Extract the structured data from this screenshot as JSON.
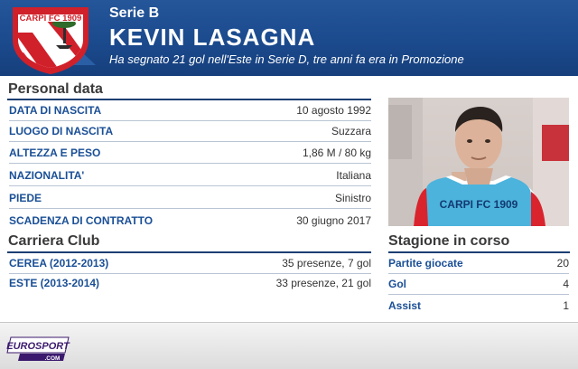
{
  "header": {
    "league": "Serie B",
    "player_name": "KEVIN LASAGNA",
    "subtitle": "Ha segnato 21 gol nell'Este in Serie D, tre anni fa era in Promozione",
    "crest_text": "CARPI FC 1909"
  },
  "personal": {
    "title": "Personal data",
    "rows": [
      {
        "label": "DATA DI NASCITA",
        "value": "10 agosto 1992"
      },
      {
        "label": "LUOGO DI NASCITA",
        "value": "Suzzara"
      },
      {
        "label": "ALTEZZA E PESO",
        "value": "1,86 M / 80 kg"
      },
      {
        "label": "NAZIONALITA'",
        "value": "Italiana"
      },
      {
        "label": "PIEDE",
        "value": "Sinistro"
      },
      {
        "label": "SCADENZA DI CONTRATTO",
        "value": "30 giugno 2017"
      }
    ]
  },
  "career": {
    "title": "Carriera Club",
    "rows": [
      {
        "label": "CEREA (2012-2013)",
        "value": "35 presenze, 7 gol"
      },
      {
        "label": "ESTE (2013-2014)",
        "value": "33 presenze, 21 gol"
      }
    ]
  },
  "season": {
    "title": "Stagione in corso",
    "rows": [
      {
        "label": "Partite giocate",
        "value": "20"
      },
      {
        "label": "Gol",
        "value": "4"
      },
      {
        "label": "Assist",
        "value": "1"
      }
    ]
  },
  "photo": {
    "shirt_text": "CARPI FC 1909"
  },
  "footer": {
    "logo_text": "EUROSPORT",
    "logo_sub": ".COM"
  },
  "colors": {
    "header_blue": "#1b4a8d",
    "label_blue": "#1a4f96",
    "crest_red": "#d0202a",
    "logo_purple": "#3b1a6e"
  }
}
